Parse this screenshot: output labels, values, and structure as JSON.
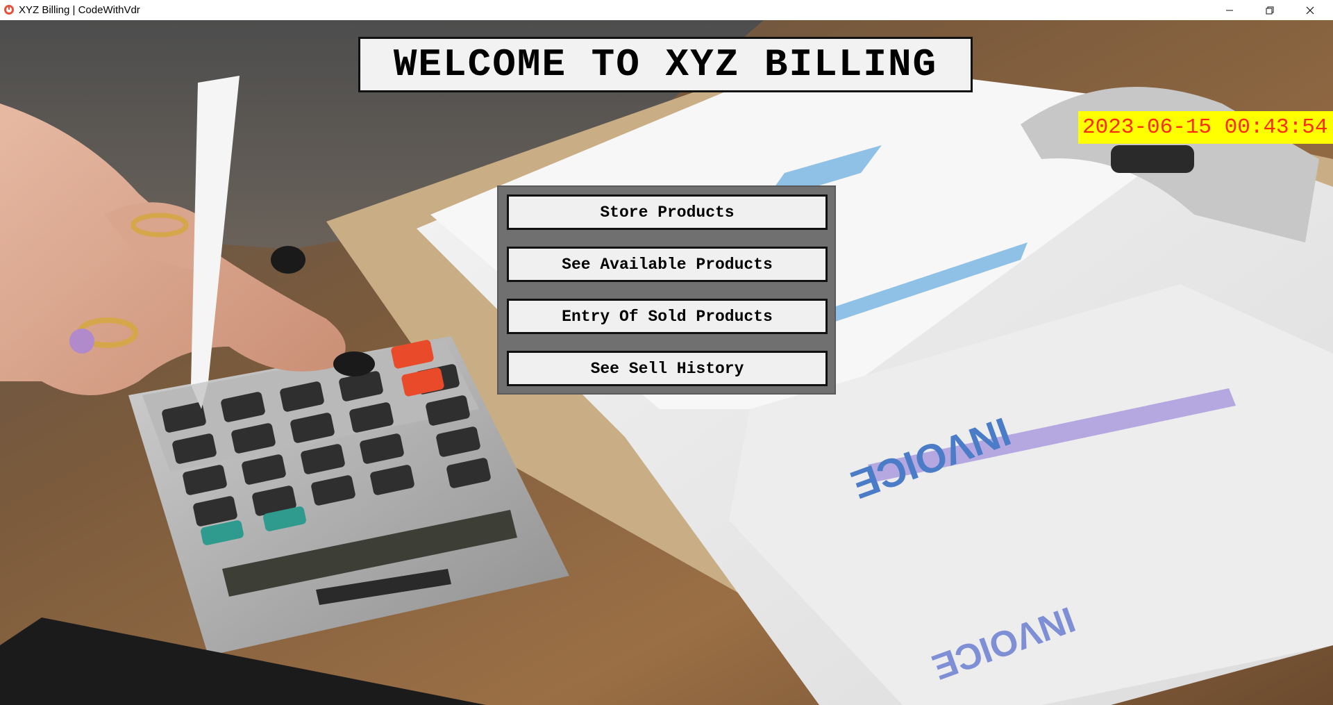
{
  "window": {
    "title": "XYZ Billing | CodeWithVdr",
    "controls": {
      "minimize_icon": "minimize-icon",
      "maximize_icon": "restore-icon",
      "close_icon": "close-icon"
    }
  },
  "main": {
    "welcome_title": "WELCOME TO XYZ BILLING",
    "clock": "2023-06-15 00:43:54",
    "menu": {
      "buttons": [
        {
          "label": "Store Products"
        },
        {
          "label": "See Available Products"
        },
        {
          "label": "Entry Of Sold Products"
        },
        {
          "label": "See Sell History"
        }
      ]
    }
  },
  "colors": {
    "clock_background": "#ffff00",
    "clock_text": "#ff2a00",
    "panel": "#707070",
    "button": "#f0f0f0"
  }
}
